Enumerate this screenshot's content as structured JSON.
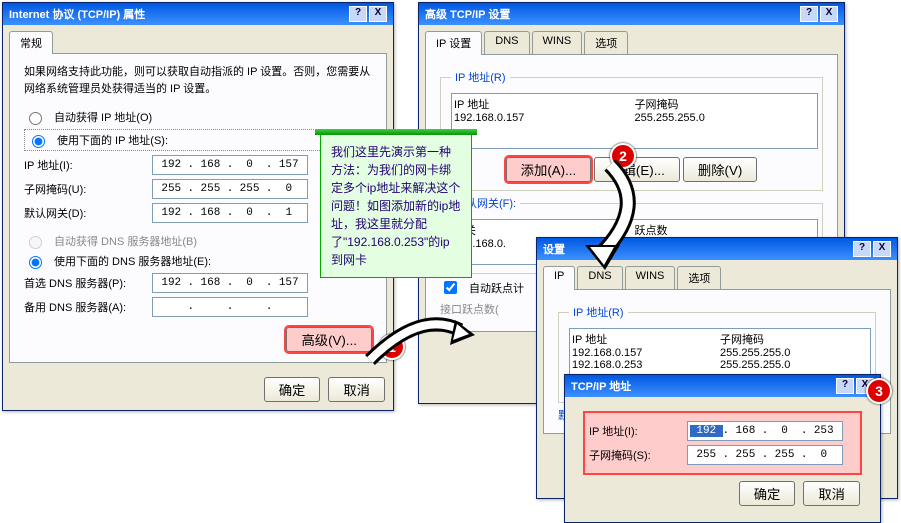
{
  "dlg1": {
    "title": "Internet 协议 (TCP/IP) 属性",
    "tabs": [
      "常规"
    ],
    "desc": "如果网络支持此功能，则可以获取自动指派的 IP 设置。否则，您需要从网络系统管理员处获得适当的 IP 设置。",
    "radio_auto_ip": "自动获得 IP 地址(O)",
    "radio_use_ip": "使用下面的 IP 地址(S):",
    "ip_label": "IP 地址(I):",
    "ip_val": [
      "192",
      "168",
      "0",
      "157"
    ],
    "mask_label": "子网掩码(U):",
    "mask_val": [
      "255",
      "255",
      "255",
      "0"
    ],
    "gw_label": "默认网关(D):",
    "gw_val": [
      "192",
      "168",
      "0",
      "1"
    ],
    "radio_auto_dns": "自动获得 DNS 服务器地址(B)",
    "radio_use_dns": "使用下面的 DNS 服务器地址(E):",
    "dns1_label": "首选 DNS 服务器(P):",
    "dns1_val": [
      "192",
      "168",
      "0",
      "157"
    ],
    "dns2_label": "备用 DNS 服务器(A):",
    "advanced": "高级(V)...",
    "ok": "确定",
    "cancel": "取消"
  },
  "dlg2": {
    "title": "高级 TCP/IP 设置",
    "tabs": [
      "IP 设置",
      "DNS",
      "WINS",
      "选项"
    ],
    "ip_legend": "IP 地址(R)",
    "col_ip": "IP 地址",
    "col_mask": "子网掩码",
    "rows": [
      {
        "ip": "192.168.0.157",
        "mask": "255.255.255.0"
      }
    ],
    "add": "添加(A)...",
    "edit": "编辑(E)...",
    "del": "删除(V)",
    "gw_legend": "默认网关(F):",
    "col_gw": "网关",
    "col_hop": "跃点数",
    "gw_rows": [
      {
        "gw": "192.168.0.",
        "hop": ""
      }
    ],
    "auto_hop": "自动跃点计",
    "if_hop": "接口跃点数("
  },
  "dlg3": {
    "title": "设置",
    "tabs": [
      "IP",
      "DNS",
      "WINS",
      "选项"
    ],
    "ip_legend": "IP 地址(R)",
    "col_ip": "IP 地址",
    "col_mask": "子网掩码",
    "rows": [
      {
        "ip": "192.168.0.157",
        "mask": "255.255.255.0"
      },
      {
        "ip": "192.168.0.253",
        "mask": "255.255.255.0"
      }
    ],
    "gw_legend": "默"
  },
  "dlg4": {
    "title": "TCP/IP 地址",
    "ip_label": "IP 地址(I):",
    "ip_val": [
      "192",
      "168",
      "0",
      "253"
    ],
    "mask_label": "子网掩码(S):",
    "mask_val": [
      "255",
      "255",
      "255",
      "0"
    ],
    "ok": "确定",
    "cancel": "取消"
  },
  "callout": "我们这里先演示第一种方法：为我们的网卡绑定多个ip地址来解决这个问题！如图添加新的ip地址，我这里就分配了\"192.168.0.253\"的ip到网卡",
  "badges": {
    "b1": "1",
    "b2": "2",
    "b3": "3"
  },
  "close": "X",
  "help": "?"
}
